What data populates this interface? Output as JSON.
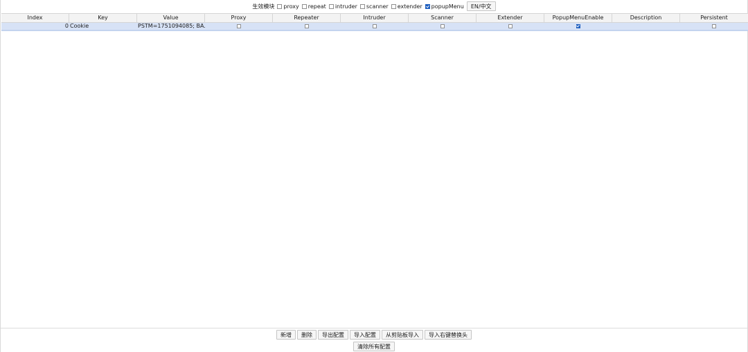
{
  "module_bar": {
    "label": "生效模块",
    "options": [
      {
        "label": "proxy",
        "checked": false
      },
      {
        "label": "repeat",
        "checked": false
      },
      {
        "label": "intruder",
        "checked": false
      },
      {
        "label": "scanner",
        "checked": false
      },
      {
        "label": "extender",
        "checked": false
      },
      {
        "label": "popupMenu",
        "checked": true
      }
    ],
    "lang_button": "EN/中文"
  },
  "table": {
    "columns": [
      "Index",
      "Key",
      "Value",
      "Proxy",
      "Repeater",
      "Intruder",
      "Scanner",
      "Extender",
      "PopupMenuEnable",
      "Description",
      "Persistent"
    ],
    "rows": [
      {
        "index": "0",
        "key": "Cookie",
        "value": "PSTM=1751094085; BA...",
        "proxy": false,
        "repeater": false,
        "intruder": false,
        "scanner": false,
        "extender": false,
        "popup_menu_enable": true,
        "description": "",
        "persistent": false
      }
    ]
  },
  "bottom_buttons": {
    "add": "新增",
    "delete": "删除",
    "export_config": "导出配置",
    "import_config": "导入配置",
    "import_clipboard": "从剪贴板导入",
    "import_right_click": "导入右键替换头",
    "clear_all": "清除所有配置"
  },
  "colors": {
    "selected_row": "#d7e2f6",
    "header_bg": "#f3f3f3",
    "checkbox_checked": "#1f5fbf"
  }
}
